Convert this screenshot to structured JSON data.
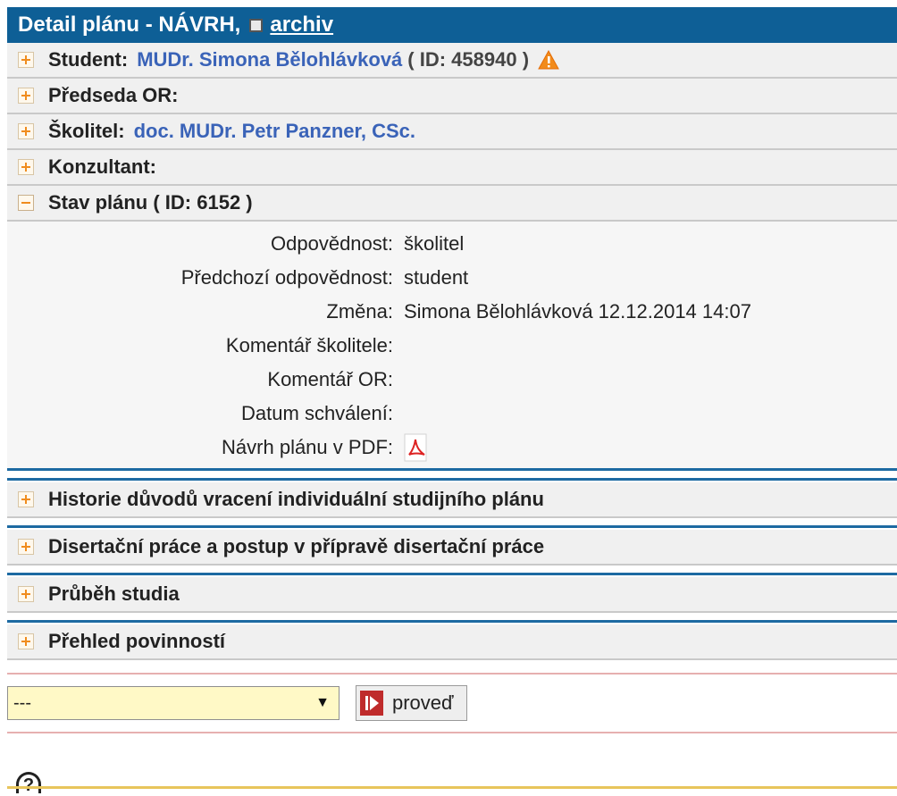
{
  "header": {
    "title": "Detail plánu - NÁVRH,",
    "archive_link": "archiv"
  },
  "sections": {
    "student": {
      "label": "Student:",
      "name": "MUDr. Simona Bělohlávková",
      "id": "( ID: 458940 )"
    },
    "predseda": {
      "label": "Předseda OR:"
    },
    "skolitel": {
      "label": "Školitel:",
      "name": "doc. MUDr. Petr Panzner, CSc."
    },
    "konzultant": {
      "label": "Konzultant:"
    },
    "stav": {
      "label": "Stav plánu ( ID: 6152 )",
      "rows": [
        {
          "label": "Odpovědnost:",
          "value": "školitel"
        },
        {
          "label": "Předchozí odpovědnost:",
          "value": "student"
        },
        {
          "label": "Změna:",
          "value": "Simona Bělohlávková 12.12.2014 14:07"
        },
        {
          "label": "Komentář školitele:",
          "value": ""
        },
        {
          "label": "Komentář OR:",
          "value": ""
        },
        {
          "label": "Datum schválení:",
          "value": ""
        },
        {
          "label": "Návrh plánu v PDF:",
          "value": ""
        }
      ]
    },
    "historie": {
      "label": "Historie důvodů vracení individuální studijního plánu"
    },
    "disertace": {
      "label": "Disertační práce a postup v přípravě disertační práce"
    },
    "prubeh": {
      "label": "Průběh studia"
    },
    "prehled": {
      "label": "Přehled povinností"
    }
  },
  "actions": {
    "select_value": "---",
    "button_label": "proveď"
  },
  "help": {
    "label": "?"
  },
  "colors": {
    "header_bg": "#0e5f96",
    "link": "#3a63b8",
    "accent": "#f08c1e",
    "select_bg": "#fff9c6"
  },
  "icons": {
    "expand": "plus-icon",
    "collapse": "minus-icon",
    "warning": "warning-icon",
    "pdf": "pdf-icon",
    "run": "play-icon"
  }
}
